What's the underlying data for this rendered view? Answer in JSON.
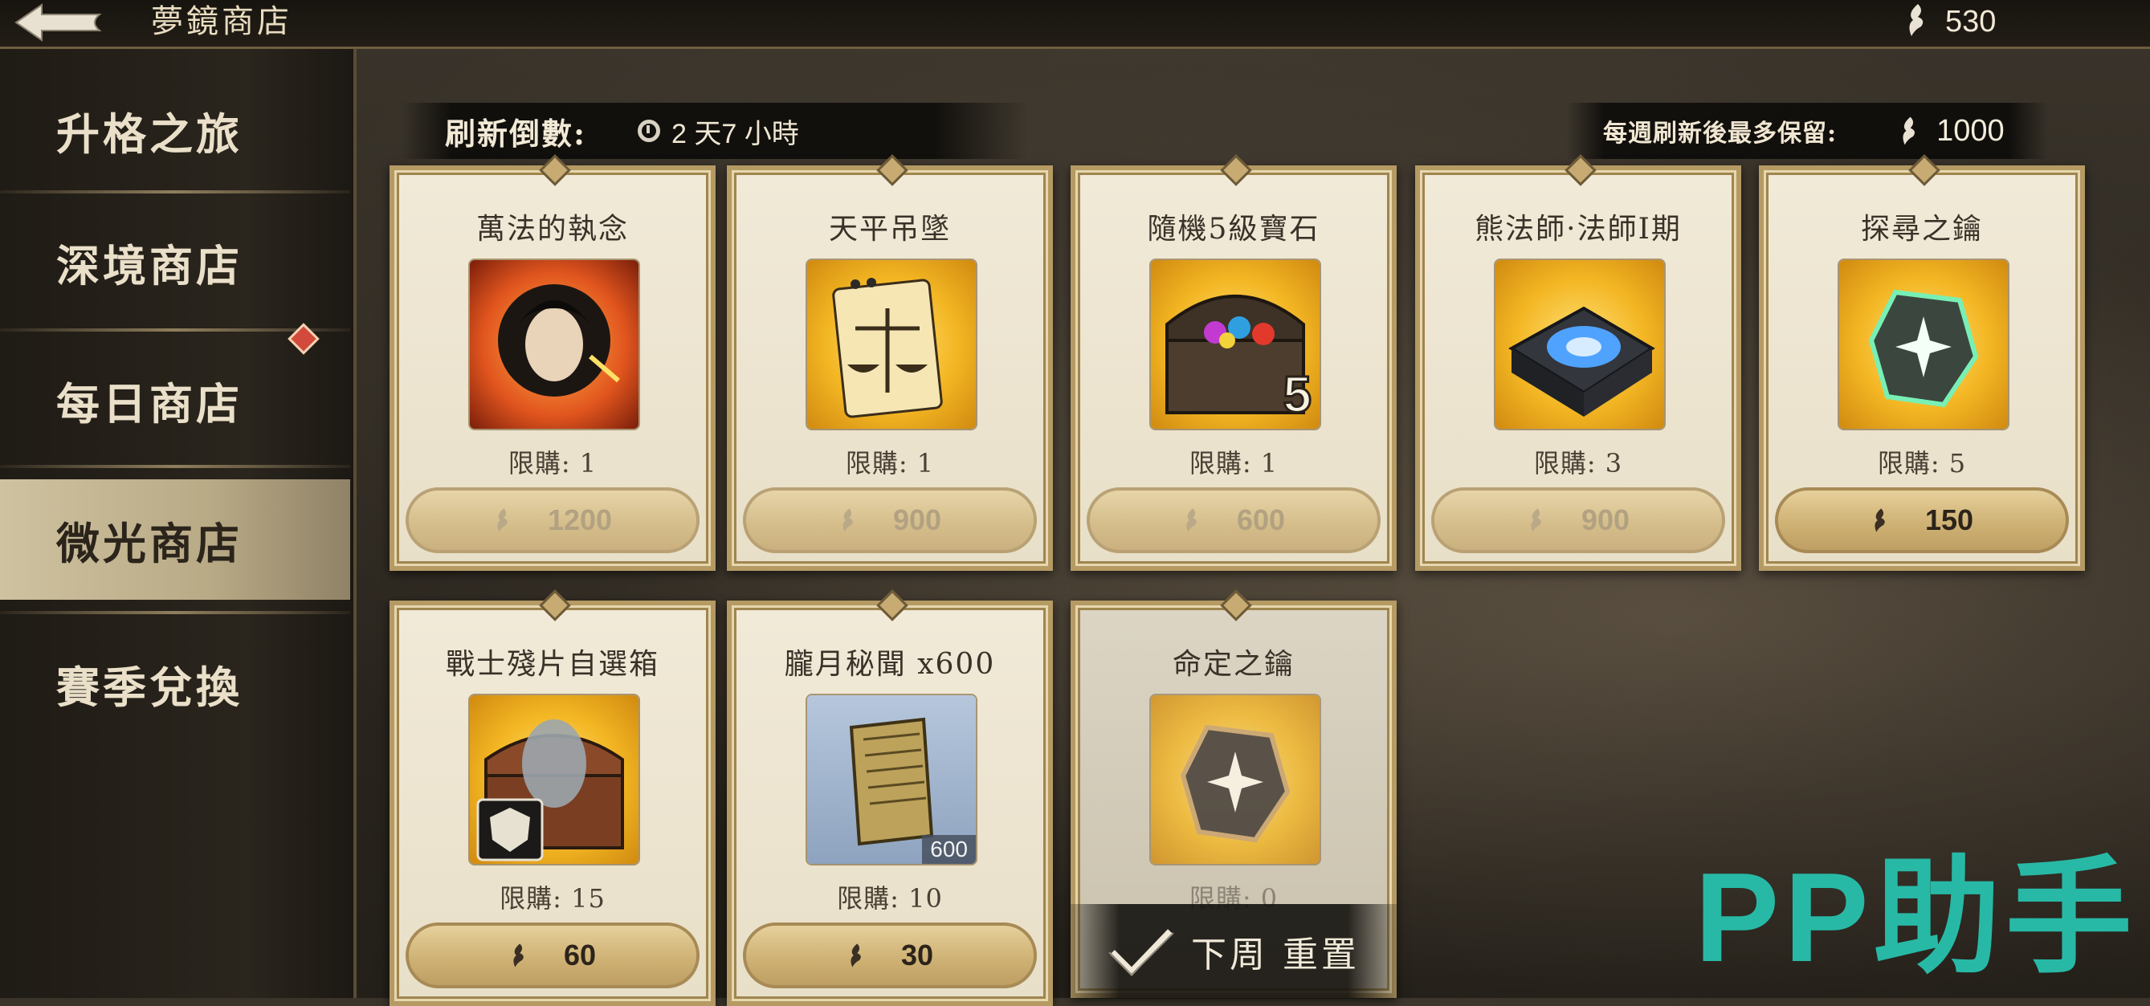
{
  "header": {
    "title": "夢鏡商店",
    "currency_amount": "530"
  },
  "sidebar": {
    "items": [
      {
        "label": "升格之旅"
      },
      {
        "label": "深境商店"
      },
      {
        "label": "每日商店"
      },
      {
        "label": "微光商店"
      },
      {
        "label": "賽季兌換"
      }
    ],
    "active_index": 3
  },
  "refresh": {
    "label": "刷新倒數:",
    "value": "2 天7 小時"
  },
  "weekly_keep": {
    "label": "每週刷新後最多保留:",
    "value": "1000"
  },
  "items": [
    {
      "name": "萬法的執念",
      "limit": "限購: 1",
      "price": "1200"
    },
    {
      "name": "天平吊墜",
      "limit": "限購: 1",
      "price": "900"
    },
    {
      "name": "隨機5級寶石",
      "limit": "限購: 1",
      "price": "600",
      "badge": "5"
    },
    {
      "name": "熊法師·法師I期",
      "limit": "限購: 3",
      "price": "900"
    },
    {
      "name": "探尋之鑰",
      "limit": "限購: 5",
      "price": "150"
    },
    {
      "name": "戰士殘片自選箱",
      "limit": "限購: 15",
      "price": "60"
    },
    {
      "name": "朧月秘聞 x600",
      "limit": "限購: 10",
      "price": "30",
      "badge": "600"
    },
    {
      "name": "命定之鑰",
      "limit": "限購: 0",
      "reset": "下周 重置"
    }
  ],
  "watermark": "PP助手",
  "colors": {
    "accent_teal": "#27b9a6",
    "card_border": "#b59a64",
    "active_tab": "#cfc2a0"
  }
}
